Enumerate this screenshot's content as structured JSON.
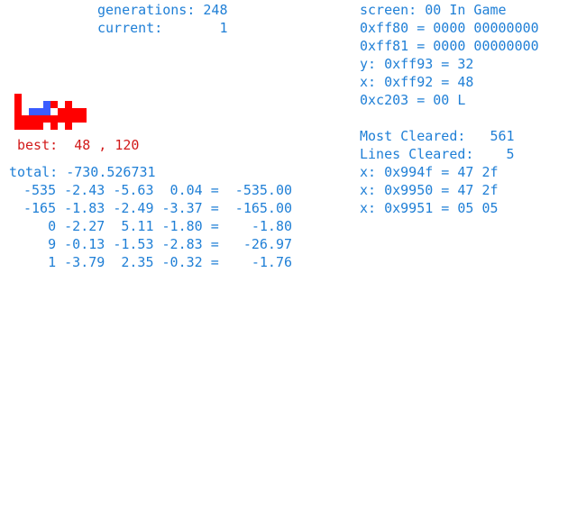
{
  "left_header": {
    "generations": "generations: 248",
    "current": "current:       1"
  },
  "best": {
    "text": "best:  48 , 120"
  },
  "total": {
    "text": "total: -730.526731"
  },
  "weights_table": {
    "rows": [
      "-535 -2.43 -5.63  0.04 =  -535.00",
      "-165 -1.83 -2.49 -3.37 =  -165.00",
      "   0 -2.27  5.11 -1.80 =    -1.80",
      "   9 -0.13 -1.53 -2.83 =   -26.97",
      "   1 -3.79  2.35 -0.32 =    -1.76"
    ]
  },
  "right_panel": {
    "screen": "screen: 00 In Game",
    "ff80": "0xff80 = 0000 00000000",
    "ff81": "0xff81 = 0000 00000000",
    "y": "y: 0xff93 = 32",
    "x": "x: 0xff92 = 48",
    "c203": "0xc203 = 00 L",
    "most_cleared": "Most Cleared:   561",
    "lines_cleared": "Lines Cleared:    5",
    "x994f": "x: 0x994f = 47 2f",
    "x9950": "x: 0x9950 = 47 2f",
    "x9951": "x: 0x9951 = 05 05"
  },
  "colors": {
    "text_blue": "#1f7fd6",
    "text_red": "#d21a1a",
    "piece_red": "#ff0000",
    "piece_blue": "#3a5cff"
  },
  "icons": {
    "board_preview": "tetris-board-preview-icon"
  }
}
